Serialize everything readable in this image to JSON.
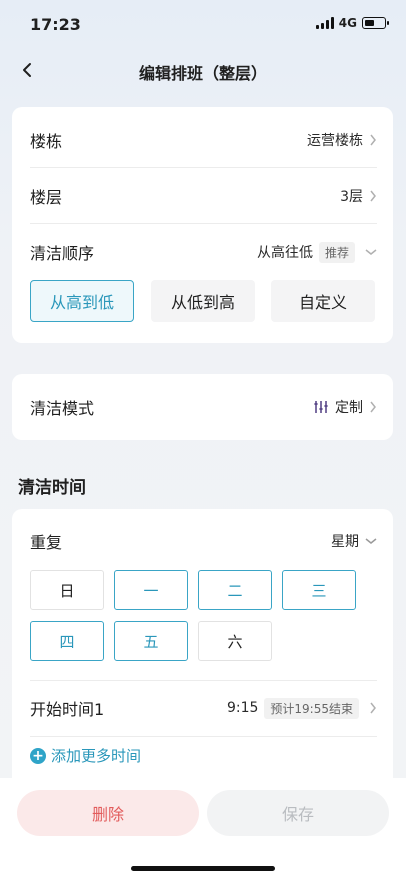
{
  "status": {
    "time": "17:23",
    "network": "4G"
  },
  "nav": {
    "title": "编辑排班（整层）"
  },
  "settings": {
    "building": {
      "label": "楼栋",
      "value": "运营楼栋"
    },
    "floor": {
      "label": "楼层",
      "value": "3层"
    },
    "order": {
      "label": "清洁顺序",
      "value": "从高往低",
      "tag": "推荐",
      "options": [
        {
          "label": "从高到低",
          "selected": true
        },
        {
          "label": "从低到高",
          "selected": false
        },
        {
          "label": "自定义",
          "selected": false
        }
      ]
    },
    "mode": {
      "label": "清洁模式",
      "value": "定制"
    }
  },
  "time_section": {
    "title": "清洁时间",
    "repeat": {
      "label": "重复",
      "value": "星期",
      "days": [
        {
          "label": "日",
          "selected": false
        },
        {
          "label": "一",
          "selected": true
        },
        {
          "label": "二",
          "selected": true
        },
        {
          "label": "三",
          "selected": true
        },
        {
          "label": "四",
          "selected": true
        },
        {
          "label": "五",
          "selected": true
        },
        {
          "label": "六",
          "selected": false
        }
      ]
    },
    "start": {
      "label": "开始时间1",
      "value": "9:15",
      "tag": "预计19:55结束"
    },
    "add_more": "添加更多时间"
  },
  "actions": {
    "delete": "删除",
    "save": "保存"
  },
  "colors": {
    "accent": "#2a97ba",
    "danger": "#e25b5b"
  }
}
